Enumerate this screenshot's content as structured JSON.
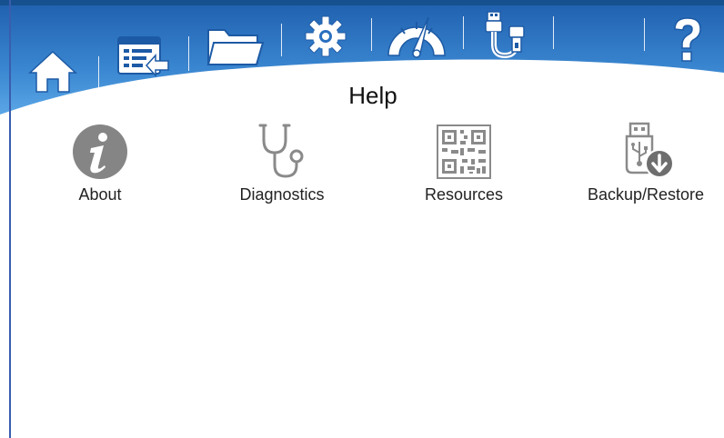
{
  "colors": {
    "banner_dark": "#1f63b3",
    "banner_light": "#4b9bdf",
    "icon_gray": "#8a8a8a",
    "border_blue": "#3a5dae"
  },
  "nav": {
    "items": [
      {
        "id": "home",
        "icon": "home-icon"
      },
      {
        "id": "import",
        "icon": "import-list-icon"
      },
      {
        "id": "files",
        "icon": "folder-icon"
      },
      {
        "id": "settings",
        "icon": "gear-icon"
      },
      {
        "id": "gauge",
        "icon": "speedometer-icon"
      },
      {
        "id": "usb",
        "icon": "usb-cable-icon"
      },
      {
        "id": "help",
        "icon": "question-mark-icon"
      }
    ]
  },
  "page": {
    "title": "Help"
  },
  "help_items": [
    {
      "label": "About",
      "icon": "info-icon"
    },
    {
      "label": "Diagnostics",
      "icon": "stethoscope-icon"
    },
    {
      "label": "Resources",
      "icon": "qr-code-icon"
    },
    {
      "label": "Backup/Restore",
      "icon": "usb-backup-icon"
    }
  ]
}
